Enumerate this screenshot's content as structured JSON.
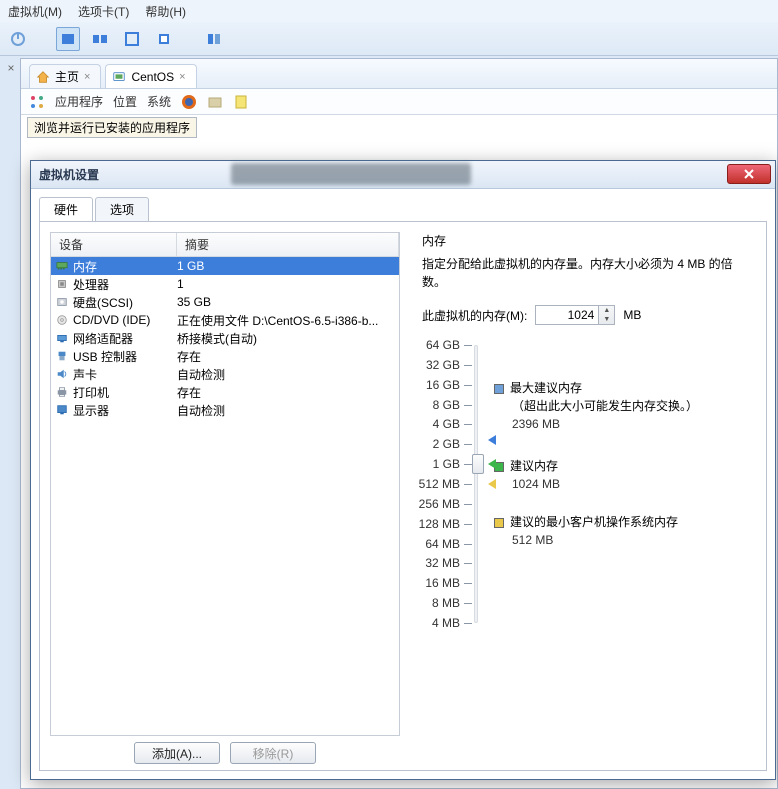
{
  "menubar": {
    "vm": "虚拟机(M)",
    "tabs": "选项卡(T)",
    "help": "帮助(H)"
  },
  "main_tabs": {
    "home": "主页",
    "centos": "CentOS"
  },
  "appbar": {
    "apps": "应用程序",
    "location": "位置",
    "system": "系统"
  },
  "tooltip": "浏览并运行已安装的应用程序",
  "dialog": {
    "title": "虚拟机设置",
    "tab_hw": "硬件",
    "tab_opt": "选项",
    "col_device": "设备",
    "col_summary": "摘要",
    "devices": [
      {
        "name": "内存",
        "summary": "1 GB",
        "icon": "mem",
        "selected": true
      },
      {
        "name": "处理器",
        "summary": "1",
        "icon": "cpu"
      },
      {
        "name": "硬盘(SCSI)",
        "summary": "35 GB",
        "icon": "hdd"
      },
      {
        "name": "CD/DVD (IDE)",
        "summary": "正在使用文件 D:\\CentOS-6.5-i386-b...",
        "icon": "cd"
      },
      {
        "name": "网络适配器",
        "summary": "桥接模式(自动)",
        "icon": "net"
      },
      {
        "name": "USB 控制器",
        "summary": "存在",
        "icon": "usb"
      },
      {
        "name": "声卡",
        "summary": "自动检测",
        "icon": "snd"
      },
      {
        "name": "打印机",
        "summary": "存在",
        "icon": "prn"
      },
      {
        "name": "显示器",
        "summary": "自动检测",
        "icon": "dsp"
      }
    ],
    "btn_add": "添加(A)...",
    "btn_remove": "移除(R)",
    "mem": {
      "heading": "内存",
      "desc": "指定分配给此虚拟机的内存量。内存大小必须为 4 MB 的倍数。",
      "field_label": "此虚拟机的内存(M):",
      "value": "1024",
      "unit": "MB",
      "ticks": [
        "64 GB",
        "32 GB",
        "16 GB",
        "8 GB",
        "4 GB",
        "2 GB",
        "1 GB",
        "512 MB",
        "256 MB",
        "128 MB",
        "64 MB",
        "32 MB",
        "16 MB",
        "8 MB",
        "4 MB"
      ],
      "legend_max": "最大建议内存",
      "legend_max_note": "（超出此大小可能发生内存交换。）",
      "legend_max_val": "2396 MB",
      "legend_rec": "建议内存",
      "legend_rec_val": "1024 MB",
      "legend_min": "建议的最小客户机操作系统内存",
      "legend_min_val": "512 MB"
    }
  },
  "chart_data": {
    "type": "bar",
    "orientation": "vertical-slider",
    "title": "虚拟机内存分配滑块",
    "ylabel": "内存",
    "y_ticks_mb": [
      65536,
      32768,
      16384,
      8192,
      4096,
      2048,
      1024,
      512,
      256,
      128,
      64,
      32,
      16,
      8,
      4
    ],
    "current_value_mb": 1024,
    "markers": [
      {
        "name": "最大建议内存",
        "value_mb": 2396,
        "color": "#3e7edb"
      },
      {
        "name": "建议内存",
        "value_mb": 1024,
        "color": "#3cb54a"
      },
      {
        "name": "建议的最小客户机操作系统内存",
        "value_mb": 512,
        "color": "#e9c84a"
      }
    ]
  }
}
